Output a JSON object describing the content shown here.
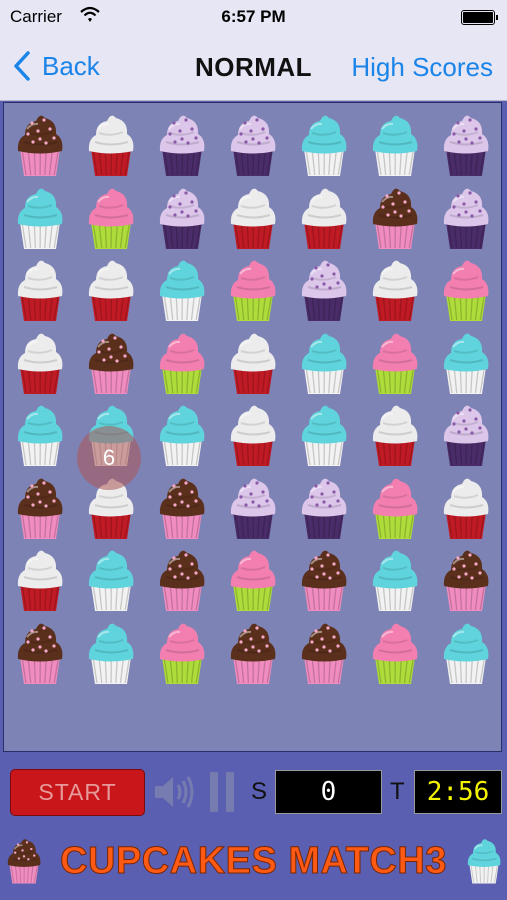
{
  "status_bar": {
    "carrier": "Carrier",
    "time": "6:57 PM"
  },
  "nav": {
    "back_label": "Back",
    "title": "NORMAL",
    "right_label": "High Scores"
  },
  "board": {
    "rows": [
      [
        "chocolate",
        "white",
        "lavender",
        "lavender",
        "teal",
        "teal",
        "lavender"
      ],
      [
        "teal",
        "pink",
        "lavender",
        "white",
        "white",
        "chocolate",
        "lavender"
      ],
      [
        "white",
        "white",
        "teal",
        "pink",
        "lavender",
        "white",
        "pink"
      ],
      [
        "white",
        "chocolate",
        "pink",
        "white",
        "teal",
        "pink",
        "teal"
      ],
      [
        "teal",
        "teal",
        "teal",
        "white",
        "teal",
        "white",
        "lavender"
      ],
      [
        "chocolate",
        "white",
        "chocolate",
        "lavender",
        "lavender",
        "pink",
        "white"
      ],
      [
        "white",
        "teal",
        "chocolate",
        "pink",
        "chocolate",
        "teal",
        "chocolate"
      ],
      [
        "chocolate",
        "teal",
        "pink",
        "chocolate",
        "chocolate",
        "pink",
        "teal"
      ]
    ],
    "badge": "6",
    "badge_cell": {
      "row": 4,
      "col": 1
    }
  },
  "cupcake_types": {
    "chocolate": {
      "frosting": "#5a2f1c",
      "wrapper": "#f08cc0",
      "sprinkles": "#f5a8c8"
    },
    "white": {
      "frosting": "#ececec",
      "wrapper": "#c01a24",
      "sprinkles": ""
    },
    "lavender": {
      "frosting": "#dcc6ea",
      "wrapper": "#4a2c68",
      "sprinkles": "#8a5aa8"
    },
    "teal": {
      "frosting": "#5fd4dc",
      "wrapper": "#f2f2f2",
      "sprinkles": ""
    },
    "pink": {
      "frosting": "#f27fb0",
      "wrapper": "#aedc3a",
      "sprinkles": ""
    }
  },
  "controls": {
    "start_label": "START",
    "score_label": "S",
    "score_value": "0",
    "time_label": "T",
    "time_value": "2:56"
  },
  "footer": {
    "title": "CUPCAKES MATCH3"
  },
  "colors": {
    "accent": "#1a84e8",
    "board_bg": "#7e83b6",
    "page_bg": "#5a5fb2",
    "start_button": "#c8161b",
    "timer_text": "#f5f400",
    "title_orange": "#ff5a14"
  }
}
